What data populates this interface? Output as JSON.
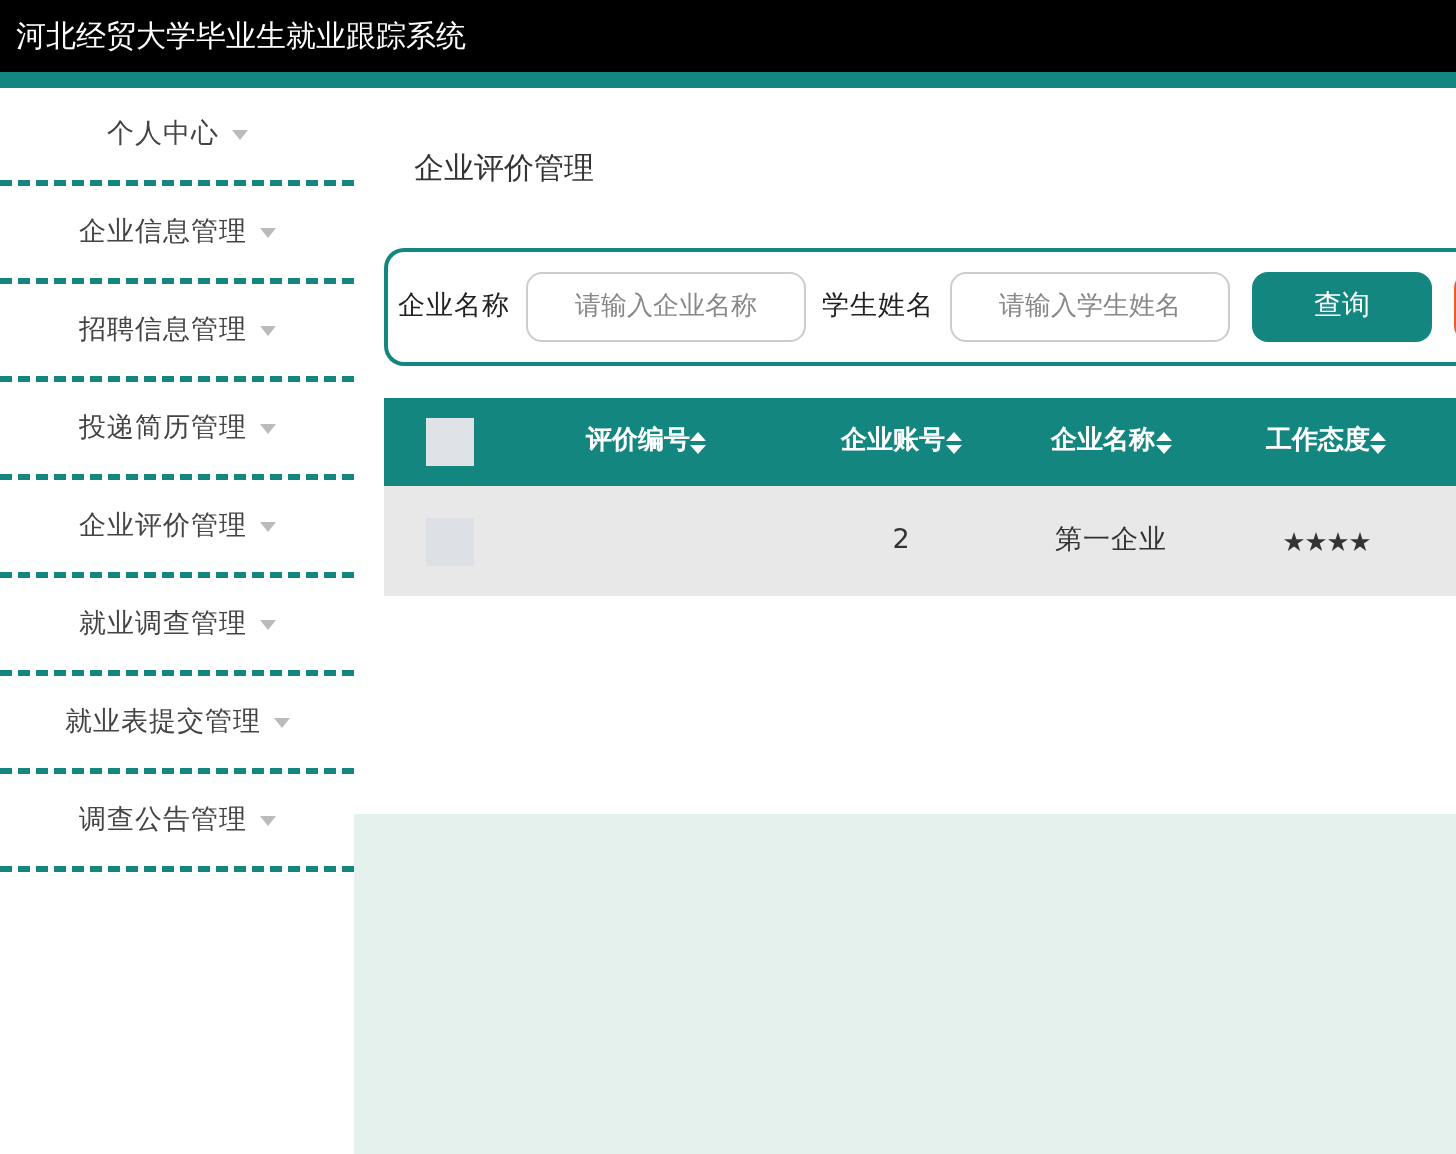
{
  "header": {
    "title": "河北经贸大学毕业生就业跟踪系统"
  },
  "sidebar": {
    "items": [
      {
        "label": "个人中心"
      },
      {
        "label": "企业信息管理"
      },
      {
        "label": "招聘信息管理"
      },
      {
        "label": "投递简历管理"
      },
      {
        "label": "企业评价管理"
      },
      {
        "label": "就业调查管理"
      },
      {
        "label": "就业表提交管理"
      },
      {
        "label": "调查公告管理"
      }
    ]
  },
  "page_title": "企业评价管理",
  "search": {
    "fields": [
      {
        "label": "企业名称",
        "placeholder": "请输入企业名称"
      },
      {
        "label": "学生姓名",
        "placeholder": "请输入学生姓名"
      }
    ],
    "query_button": "查询"
  },
  "table": {
    "columns": [
      "评价编号",
      "企业账号",
      "企业名称",
      "工作态度"
    ],
    "select_all_checked": false,
    "rows": [
      {
        "checked": false,
        "cells": [
          "",
          "2",
          "第一企业"
        ],
        "stars": 4
      }
    ]
  }
}
